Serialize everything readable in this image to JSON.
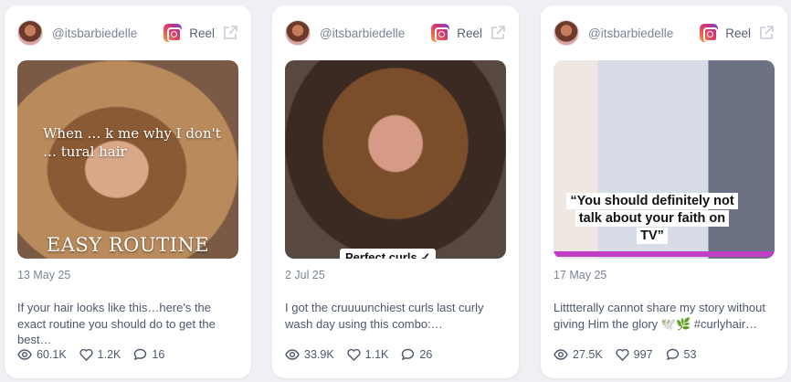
{
  "posts": [
    {
      "handle": "@itsbarbiedelle",
      "type": "Reel",
      "overlay_top": "When … k me why I don't … tural hair",
      "overlay_bottom": "EASY ROUTINE",
      "date": "13 May 25",
      "description": "If your hair looks like this…here's the exact routine you should do to get the best…",
      "views": "60.1K",
      "likes": "1.2K",
      "comments": "16"
    },
    {
      "handle": "@itsbarbiedelle",
      "type": "Reel",
      "overlay_caption": "Perfect curls ✓",
      "date": "2 Jul 25",
      "description": "I got the cruuuunchiest curls last curly wash day using this combo:…",
      "views": "33.9K",
      "likes": "1.1K",
      "comments": "26"
    },
    {
      "handle": "@itsbarbiedelle",
      "type": "Reel",
      "overlay_quote": "“You should definitely not talk about your faith on TV”",
      "date": "17 May 25",
      "description": "Litttterally cannot share my story without giving Him the glory 🕊️🌿 #curlyhair…",
      "views": "27.5K",
      "likes": "997",
      "comments": "53"
    }
  ],
  "icons": {
    "platform": "instagram-icon",
    "open": "external-link-icon",
    "views": "eye-icon",
    "likes": "heart-icon",
    "comments": "comment-icon"
  },
  "colors": {
    "background": "#eef0f4",
    "card": "#ffffff",
    "muted_text": "#7b8394",
    "body_text": "#4d586c",
    "accent_bar": "#c03ec6"
  }
}
